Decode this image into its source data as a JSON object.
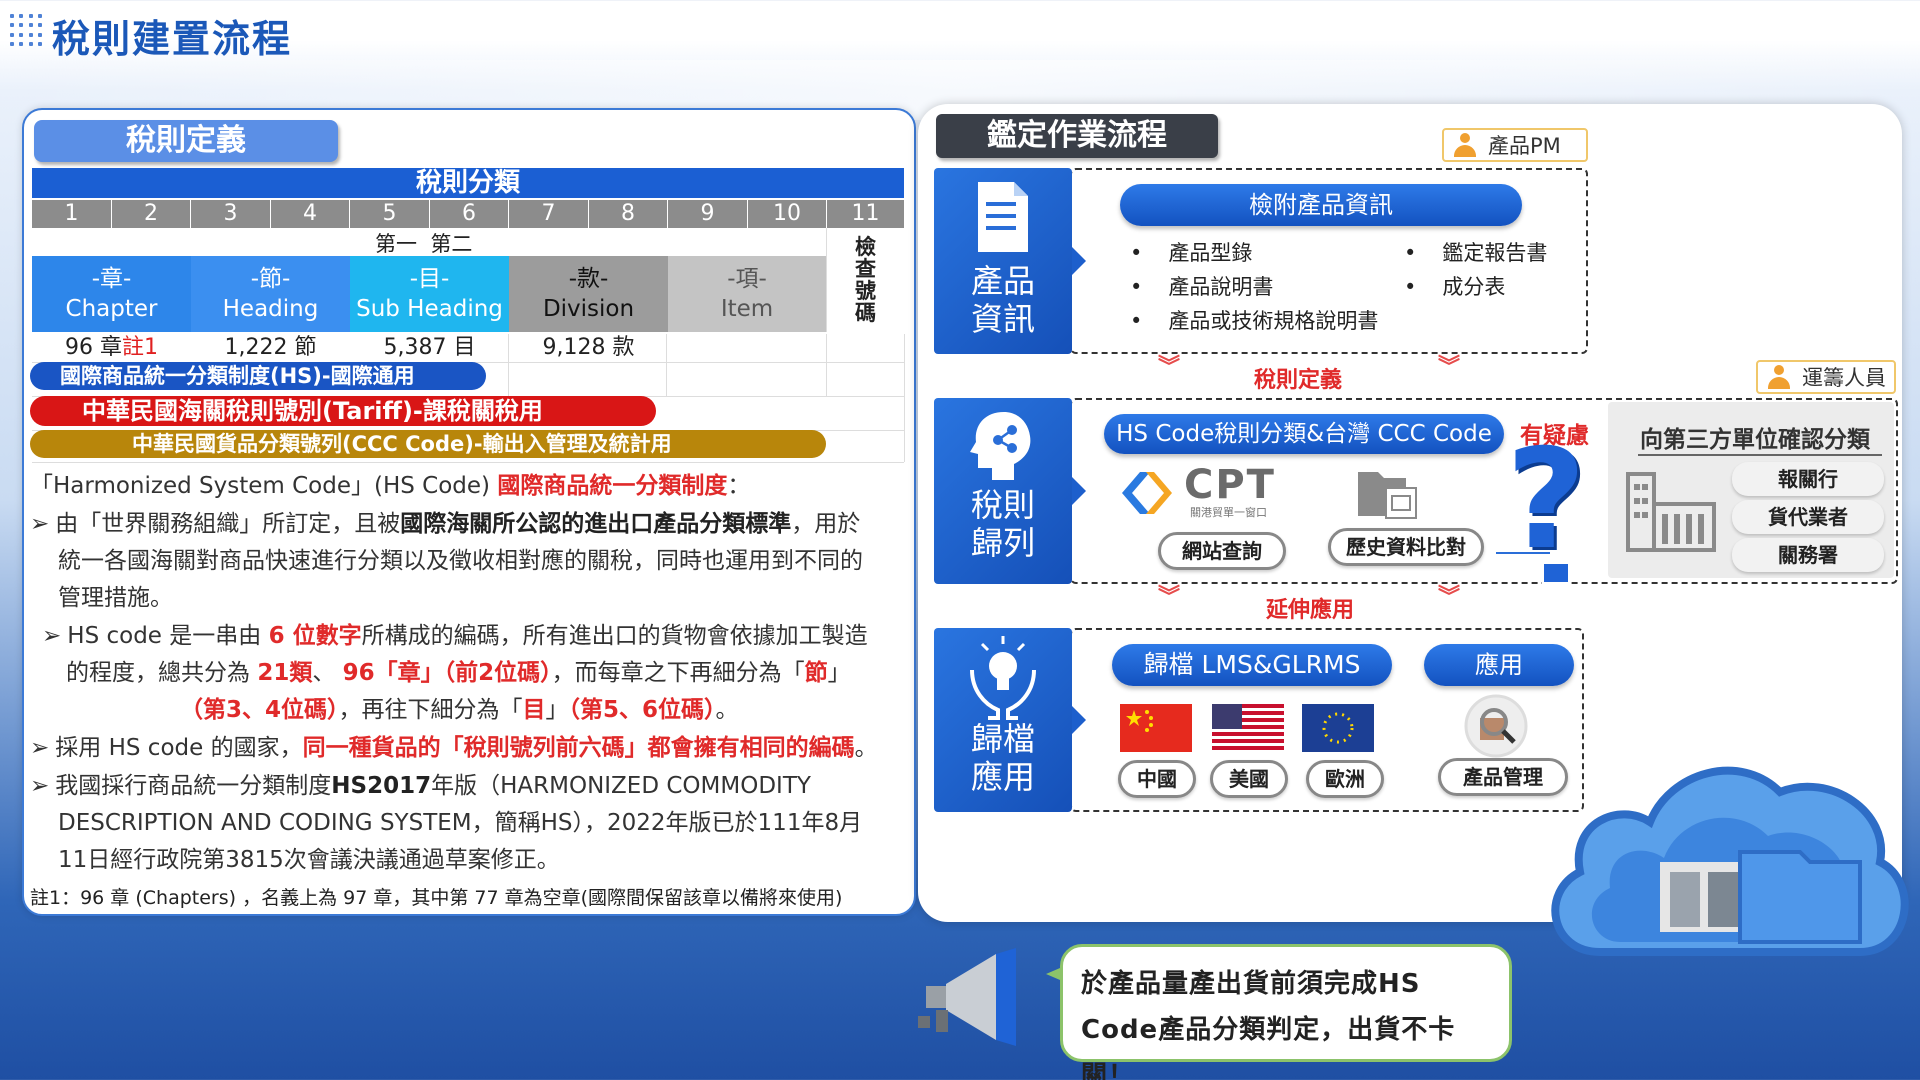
{
  "header": {
    "title": "稅則建置流程"
  },
  "left": {
    "title": "稅則定義",
    "table_title": "稅則分類",
    "digits": [
      "1",
      "2",
      "3",
      "4",
      "5",
      "6",
      "7",
      "8",
      "9",
      "10",
      "11"
    ],
    "sub_label": "第一  第二",
    "check_code": [
      "檢",
      "查",
      "號",
      "碼"
    ],
    "categories": [
      {
        "zh": "-章-",
        "en": "Chapter"
      },
      {
        "zh": "-節-",
        "en": "Heading"
      },
      {
        "zh": "-目-",
        "en": "Sub Heading"
      },
      {
        "zh": "-款-",
        "en": "Division"
      },
      {
        "zh": "-項-",
        "en": "Item"
      }
    ],
    "counts": {
      "chapter": "96 章",
      "note": "註1",
      "heading": "1,222 節",
      "subheading": "5,387 目",
      "division": "9,128 款"
    },
    "bands": [
      "國際商品統一分類制度(HS)-國際通用",
      "中華民國海關稅則號別(Tariff)-課稅關稅用",
      "中華民國貨品分類號列(CCC Code)-輸出入管理及統計用"
    ],
    "desc": {
      "intro": "「Harmonized System Code」(HS Code)",
      "intro_hl": "國際商品統一分類制度",
      "intro_tail": "：",
      "p1a": "由「世界關務組織」所訂定，且被",
      "p1b": "國際海關所公認的進出口產品分類標準",
      "p1c": "，用於",
      "p1d": "統一各國海關對商品快速進行分類以及徵收相對應的關稅，同時也運用到不同的",
      "p1e": "管理措施。",
      "p2a": "HS code 是一串由",
      "p2b": "6 位數字",
      "p2c": "所構成的編碼，所有進出口的貨物會依據加工製造",
      "p2d": "的程度，總共分為",
      "p2e": "21類",
      "p2f": "、",
      "p2g": "96「章」（前2位碼）",
      "p2h": "，而每章之下再細分為「",
      "p2i": "節",
      "p2j": "」",
      "p2k": "（第3、4位碼）",
      "p2l": "，再往下細分為「",
      "p2m": "目",
      "p2n": "」",
      "p2o": "（第5、6位碼）",
      "p2p": "。",
      "p3a": "採用 HS code 的國家，",
      "p3b": "同一種貨品的「稅則號列前六碼」都會擁有相同的編碼",
      "p3c": "。",
      "p4a": "我國採行商品統一分類制度",
      "p4b": "HS2017",
      "p4c": "年版（HARMONIZED COMMODITY",
      "p4d": "DESCRIPTION AND CODING SYSTEM，簡稱HS），2022年版已於111年8月",
      "p4e": "11日經行政院第3815次會議決議通過草案修正。",
      "note": "註1：96 章 (Chapters) ，名義上為 97 章，其中第 77 章為空章(國際間保留該章以備將來使用)"
    }
  },
  "right": {
    "title": "鑑定作業流程",
    "tag_pm": "產品PM",
    "tag_logistics": "運籌人員",
    "step1": [
      "產品",
      "資訊"
    ],
    "step2": [
      "稅則",
      "歸列"
    ],
    "step3": [
      "歸檔",
      "應用"
    ],
    "s1_pill": "檢附產品資訊",
    "s1_items_left": [
      "產品型錄",
      "產品說明書",
      "產品或技術規格說明書"
    ],
    "s1_items_right": [
      "鑑定報告書",
      "成分表"
    ],
    "bullet": "•",
    "mid1": "稅則定義",
    "mid2": "延伸應用",
    "s2_pill": "HS Code稅則分類&台灣 CCC Code",
    "doubt": "有疑慮",
    "cpt_logo": "CPT",
    "cpt_sub": "關港貿單一窗口",
    "web_query": "網站查詢",
    "history": "歷史資料比對",
    "third_party": "向第三方單位確認分類",
    "third_items": [
      "報關行",
      "貨代業者",
      "關務署"
    ],
    "s3_pill": "歸檔 LMS&GLRMS",
    "s3_apply": "應用",
    "flags": [
      "中國",
      "美國",
      "歐洲"
    ],
    "product_mgmt": "產品管理",
    "callout": [
      "於產品量產出貨前須完成HS",
      "Code產品分類判定，出貨不卡關！"
    ]
  }
}
